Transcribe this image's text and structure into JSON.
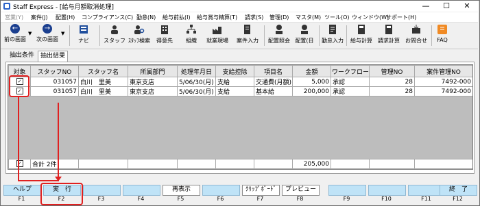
{
  "window": {
    "title": "Staff Express - [給与月額取消処理]",
    "minimize": "—",
    "maximize": "☐",
    "close": "✕"
  },
  "menu": [
    {
      "label": "営業(Y)",
      "dim": true
    },
    {
      "label": "案件(J)"
    },
    {
      "label": "配置(H)"
    },
    {
      "label": "コンプライアンス(C)"
    },
    {
      "label": "勤怠(N)"
    },
    {
      "label": "給与前払(I)"
    },
    {
      "label": "給与賞与精算(T)"
    },
    {
      "label": "請求(S)"
    },
    {
      "label": "管理(D)"
    },
    {
      "label": "マスタ(M)"
    },
    {
      "label": "ツール(O)"
    },
    {
      "label": "ウィンドウ(W)"
    },
    {
      "label": "サポート(H)"
    }
  ],
  "toolbar": {
    "back": "前の画面",
    "forward": "次の画面",
    "navi": "ナビ",
    "staff": "スタッフ",
    "staff_search": "ｽﾀｯﾌ検索",
    "client": "得意先",
    "org": "組織",
    "site": "就業現場",
    "job_entry": "案件入力",
    "assign_inquiry": "配置照会",
    "assign_day": "配置(日",
    "attendance": "勤怠入力",
    "payroll": "給与計算",
    "billing": "請求計算",
    "contact": "お問合せ",
    "faq": "FAQ"
  },
  "tabs": {
    "conditions": "抽出条件",
    "results": "抽出結果"
  },
  "table": {
    "headers": [
      "対象",
      "スタッフNO",
      "スタッフ名",
      "所属部門",
      "処理年月日",
      "支給控除",
      "項目名",
      "金額",
      "ワークフロー",
      "管理NO",
      "案件管理NO"
    ],
    "rows": [
      {
        "staff_no": "031057",
        "staff_name": "白川　里美",
        "dept": "東京支店",
        "date": "5/06/30(月)",
        "kind": "支給",
        "item": "交通費(月額)",
        "amount": "5,000",
        "workflow": "承認",
        "mgmt_no": "28",
        "job_no": "7492-000"
      },
      {
        "staff_no": "031057",
        "staff_name": "白川　里美",
        "dept": "東京支店",
        "date": "5/06/30(月)",
        "kind": "支給",
        "item": "基本給",
        "amount": "200,000",
        "workflow": "承認",
        "mgmt_no": "28",
        "job_no": "7492-000"
      }
    ],
    "total_label": "合計 2件",
    "total_amount": "205,000"
  },
  "fkeys": {
    "f1": "ヘルプ",
    "f2": "実　行",
    "f5": "再表示",
    "f7": "ｸﾘｯﾌﾟﾎﾞｰﾄﾞ",
    "f8": "プレビュー",
    "f12": "終　了",
    "n1": "F1",
    "n2": "F2",
    "n3": "F3",
    "n4": "F4",
    "n5": "F5",
    "n6": "F6",
    "n7": "F7",
    "n8": "F8",
    "n9": "F9",
    "n10": "F10",
    "n11": "F11",
    "n12": "F12"
  },
  "colors": {
    "accent_red": "#e02020",
    "fkey_blue": "#bfe3f7"
  }
}
